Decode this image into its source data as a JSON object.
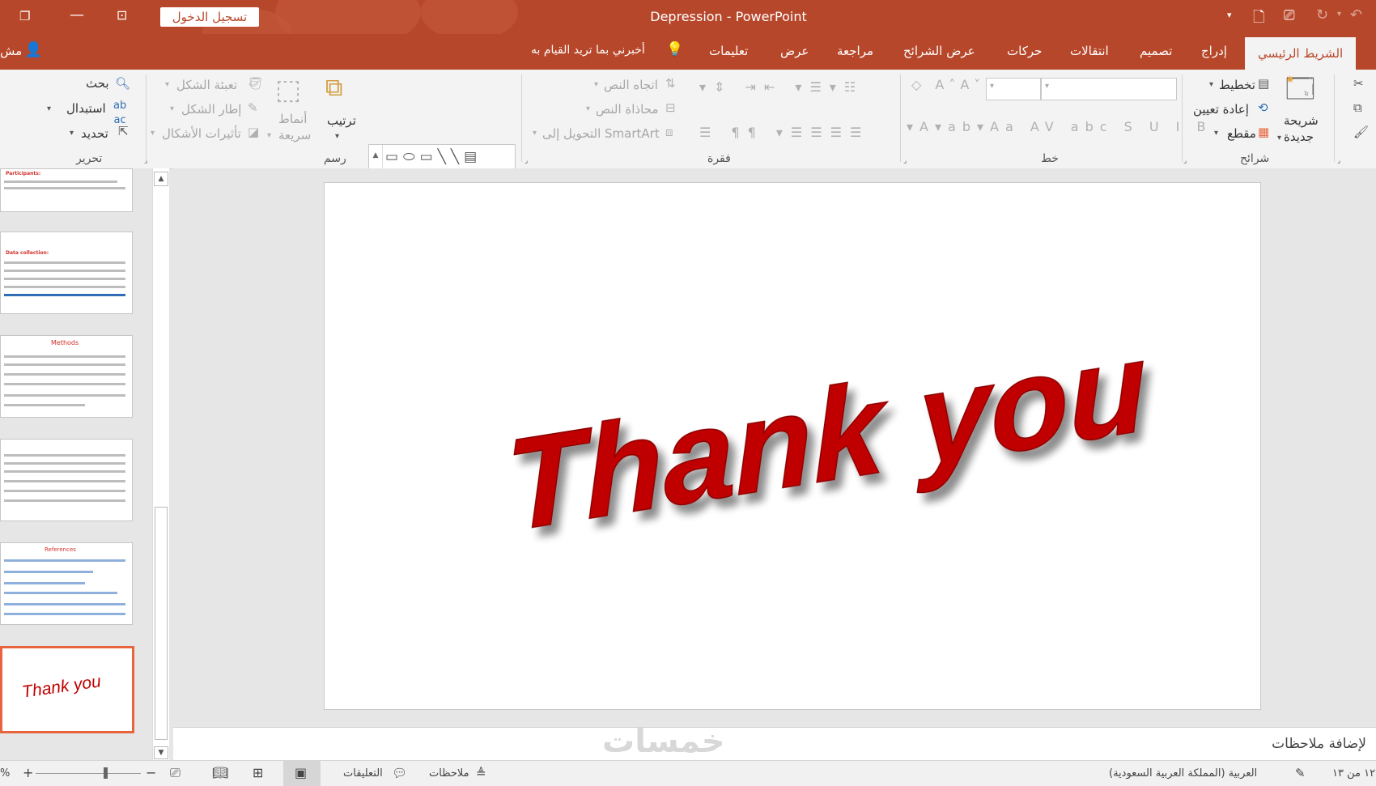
{
  "window": {
    "title": "Depression  -  PowerPoint",
    "signin_label": "تسجيل الدخول",
    "share_label": "مش"
  },
  "colors": {
    "accent": "#b7472a",
    "thank_you": "#c00000",
    "thumb_selected": "#e8643c"
  },
  "tabs": [
    {
      "label": "الشريط الرئيسي",
      "active": true
    },
    {
      "label": "إدراج"
    },
    {
      "label": "تصميم"
    },
    {
      "label": "انتقالات"
    },
    {
      "label": "حركات"
    },
    {
      "label": "عرض الشرائح"
    },
    {
      "label": "مراجعة"
    },
    {
      "label": "عرض"
    },
    {
      "label": "تعليمات"
    }
  ],
  "tell_me": "أخبرني بما تريد القيام به",
  "ribbon": {
    "slides": {
      "group": "شرائح",
      "new_slide": [
        "شريحة",
        "جديدة"
      ],
      "layout": "تخطيط",
      "reset": "إعادة تعيين",
      "section": "مقطع"
    },
    "font": {
      "group": "خط",
      "size_placeholder": "",
      "name_placeholder": ""
    },
    "paragraph": {
      "group": "فقرة",
      "text_direction": "اتجاه النص",
      "align_text": "محاذاة النص",
      "smartart": "التحويل إلى SmartArt"
    },
    "drawing": {
      "group": "رسم",
      "arrange": "ترتيب",
      "quick_styles": [
        "أنماط",
        "سريعة"
      ],
      "shape_fill": "تعبئة الشكل",
      "shape_outline": "إطار الشكل",
      "shape_effects": "تأثيرات الأشكال"
    },
    "editing": {
      "group": "تحرير",
      "find": "بحث",
      "replace": "استبدال",
      "select": "تحديد"
    }
  },
  "thumbnails": [
    {
      "heading": "Participants:",
      "kind": "text"
    },
    {
      "heading": "Data collection:",
      "kind": "text"
    },
    {
      "heading": "Methods",
      "kind": "text"
    },
    {
      "heading": "",
      "kind": "text"
    },
    {
      "heading": "References",
      "kind": "text"
    },
    {
      "heading": "Thank you",
      "kind": "thankyou",
      "selected": true
    }
  ],
  "slide": {
    "text": "Thank you"
  },
  "notes_placeholder": "لإضافة ملاحظات",
  "watermark": "خمسات",
  "status": {
    "slide_count": "١٢ من ١٣",
    "language": "العربية (المملكة العربية السعودية)",
    "notes_label": "ملاحظات",
    "comments_label": "التعليقات",
    "zoom": "%"
  }
}
